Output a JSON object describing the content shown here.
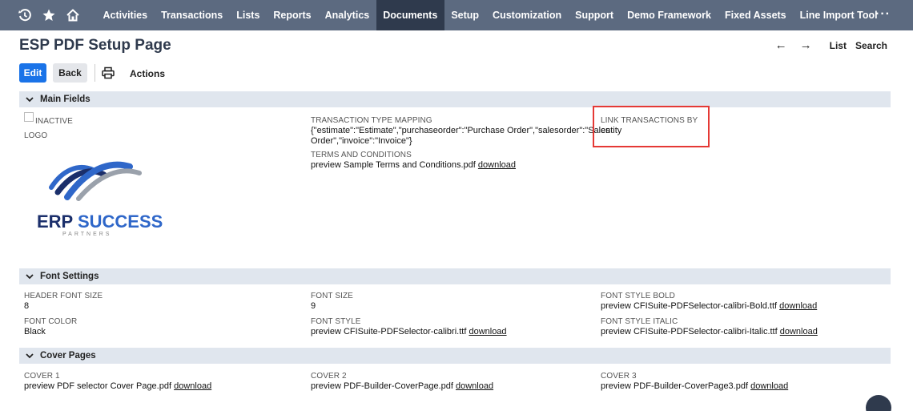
{
  "nav": {
    "icons": [
      "history-icon",
      "star-icon",
      "home-icon"
    ],
    "items": [
      "Activities",
      "Transactions",
      "Lists",
      "Reports",
      "Analytics",
      "Documents",
      "Setup",
      "Customization",
      "Support",
      "Demo Framework",
      "Fixed Assets",
      "Line Import Tool"
    ],
    "active": "Documents",
    "more": "···"
  },
  "page": {
    "title": "ESP PDF Setup Page",
    "nav_list": "List",
    "nav_search": "Search",
    "back_arrow": "←",
    "forward_arrow": "→"
  },
  "toolbar": {
    "edit": "Edit",
    "back": "Back",
    "actions": "Actions"
  },
  "main_fields": {
    "header": "Main Fields",
    "inactive_label": "INACTIVE",
    "logo_label": "LOGO",
    "logo_text_erp": "ERP",
    "logo_text_success": " SUCCESS",
    "logo_sub": "PARTNERS",
    "ttm_label": "TRANSACTION TYPE MAPPING",
    "ttm_line1": "{\"estimate\":\"Estimate\",\"purchaseorder\":\"Purchase Order\",\"salesorder\":\"Sales",
    "ttm_line2": "Order\",\"invoice\":\"Invoice\"}",
    "terms_label": "TERMS AND CONDITIONS",
    "terms_value": "preview Sample Terms and Conditions.pdf",
    "link_label": "LINK TRANSACTIONS BY",
    "link_value": "entity"
  },
  "font_settings": {
    "header": "Font Settings",
    "header_font_size_label": "HEADER FONT SIZE",
    "header_font_size_value": "8",
    "font_color_label": "FONT COLOR",
    "font_color_value": "Black",
    "font_size_label": "FONT SIZE",
    "font_size_value": "9",
    "font_style_label": "FONT STYLE",
    "font_style_value": "preview CFISuite-PDFSelector-calibri.ttf",
    "font_style_bold_label": "FONT STYLE BOLD",
    "font_style_bold_value": "preview CFISuite-PDFSelector-calibri-Bold.ttf",
    "font_style_italic_label": "FONT STYLE ITALIC",
    "font_style_italic_value": "preview CFISuite-PDFSelector-calibri-Italic.ttf"
  },
  "cover_pages": {
    "header": "Cover Pages",
    "cover1_label": "COVER 1",
    "cover1_value": "preview PDF selector Cover Page.pdf",
    "cover2_label": "COVER 2",
    "cover2_value": "preview PDF-Builder-CoverPage.pdf",
    "cover3_label": "COVER 3",
    "cover3_value": "preview PDF-Builder-CoverPage3.pdf"
  },
  "download_label": "download",
  "colors": {
    "nav_bg": "#5c6a80",
    "nav_active": "#2f3a4d",
    "edit_button": "#1a73e8",
    "section_bg": "#e0e6ee",
    "highlight": "#e53935"
  }
}
